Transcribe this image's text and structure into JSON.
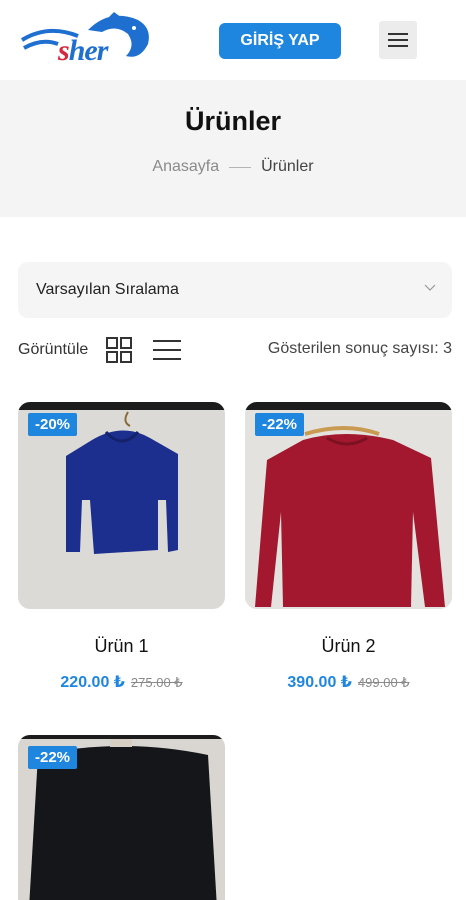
{
  "header": {
    "logo_text_s": "s",
    "logo_text_her": "her",
    "login_label": "GİRİŞ YAP",
    "menu_icon": "hamburger-menu-icon"
  },
  "title_band": {
    "title": "Ürünler",
    "breadcrumb": [
      "Anasayfa",
      "Ürünler"
    ]
  },
  "sort": {
    "selected": "Varsayılan Sıralama"
  },
  "view": {
    "label": "Görüntüle",
    "result_count": "Gösterilen sonuç sayısı: 3"
  },
  "products": [
    {
      "badge": "-20%",
      "name": "Ürün 1",
      "price": "220.00 ₺",
      "old_price": "275.00 ₺",
      "color": "#1c2f8f"
    },
    {
      "badge": "-22%",
      "name": "Ürün 2",
      "price": "390.00 ₺",
      "old_price": "499.00 ₺",
      "color": "#a3182e"
    },
    {
      "badge": "-22%",
      "name": "",
      "price": "",
      "old_price": "",
      "color": "#15161a"
    }
  ],
  "colors": {
    "accent": "#1f86e0",
    "band_bg": "#f4f4f4"
  }
}
